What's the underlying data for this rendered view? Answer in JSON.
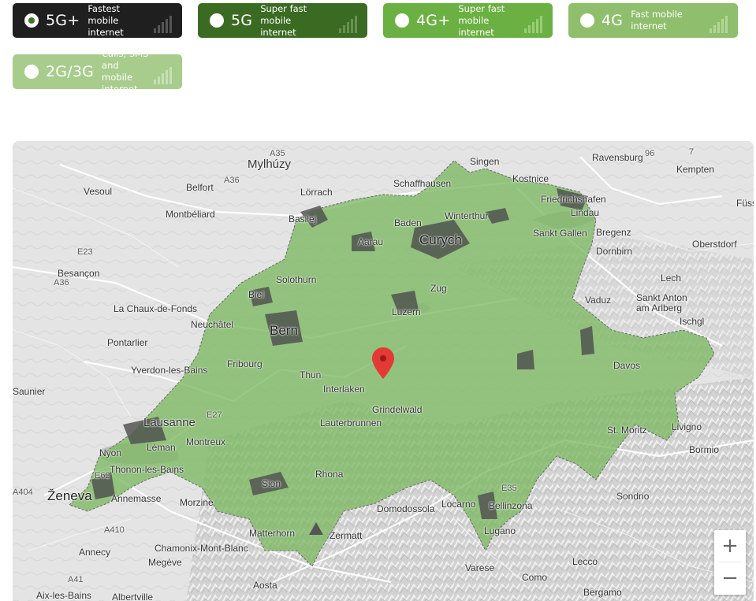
{
  "filters": [
    {
      "id": "5gplus",
      "gen": "5G+",
      "desc": "Fastest mobile internet",
      "color": "#1f1f1f",
      "selected": true
    },
    {
      "id": "5g",
      "gen": "5G",
      "desc": "Super fast mobile internet",
      "color": "#3b6b22",
      "selected": false
    },
    {
      "id": "4gplus",
      "gen": "4G+",
      "desc": "Super fast mobile internet",
      "color": "#6bb042",
      "selected": false
    },
    {
      "id": "4g",
      "gen": "4G",
      "desc": "Fast mobile internet",
      "color": "#8fbe6c",
      "selected": false
    },
    {
      "id": "2g3g",
      "gen": "2G/3G",
      "desc": "Calls, SMS and mobile internet",
      "color": "#a7cc8b",
      "selected": false
    }
  ],
  "map": {
    "coverage_color": "#7cb862",
    "labels": {
      "mylhuzy": "Mylhúzy",
      "singen": "Singen",
      "ravensburg": "Ravensburg",
      "kempten": "Kempten",
      "vesoul": "Vesoul",
      "belfort": "Belfort",
      "lorrach": "Lörrach",
      "schaffhausen": "Schaffhausen",
      "kostnice": "Kostnice",
      "friedrichshafen": "Friedrichshafen",
      "lindau": "Lindau",
      "fussen": "Füss",
      "montbeliard": "Montbéliard",
      "basilej": "Basilej",
      "winterthur": "Winterthur",
      "baden": "Baden",
      "curych": "Curych",
      "sanktgallen": "Sankt Gallen",
      "bregenz": "Bregenz",
      "oberstdorf": "Oberstdorf",
      "dornbirn": "Dornbirn",
      "besancon": "Besançon",
      "aarau": "Aarau",
      "solothurn": "Solothurn",
      "zug": "Zug",
      "lech": "Lech",
      "biel": "Biel",
      "vaduz": "Vaduz",
      "sanktanton": "Sankt Anton am Arlberg",
      "lachauxdefonds": "La Chaux-de-Fonds",
      "luzern": "Luzern",
      "ischgl": "Ischgl",
      "neuchatel": "Neuchâtel",
      "bern": "Bern",
      "pontarlier": "Pontarlier",
      "davos": "Davos",
      "yverdon": "Yverdon-les-Bains",
      "fribourg": "Fribourg",
      "thun": "Thun",
      "saunier": "Saunier",
      "interlaken": "Interlaken",
      "grindelwald": "Grindelwald",
      "lausanne": "Lausanne",
      "lauterbrunnen": "Lauterbrunnen",
      "stmoritz": "St. Moritz",
      "livigno": "Livigno",
      "montreux": "Montreux",
      "nyon": "Nyon",
      "bormio": "Bormio",
      "thonon": "Thonon-les-Bains",
      "sion": "Sion",
      "zeneva": "Ženeva",
      "annemasse": "Annemasse",
      "morzine": "Morzine",
      "domodossola": "Domodossola",
      "locarno": "Locarno",
      "bellinzona": "Bellinzona",
      "sondrio": "Sondrio",
      "matterhorn": "Matterhorn",
      "zermatt": "Zermatt",
      "lugano": "Lugano",
      "annecy": "Annecy",
      "chamonix": "Chamonix-Mont-Blanc",
      "megeve": "Megève",
      "lecco": "Lecco",
      "varese": "Varese",
      "aosta": "Aosta",
      "como": "Como",
      "bergamo": "Bergamo",
      "aixlesbains": "Aix-les-Bains",
      "albertville": "Albertville",
      "leman": "Léman",
      "rhona": "Rhona",
      "a35": "A35",
      "a36": "A36",
      "e23": "E23",
      "a36b": "A36",
      "e27": "E27",
      "e62": "E62",
      "a404": "A404",
      "a410": "A410",
      "a41": "A41",
      "e35": "E35",
      "r96": "96",
      "r7": "7"
    },
    "zoom_in": "+",
    "zoom_out": "−"
  }
}
